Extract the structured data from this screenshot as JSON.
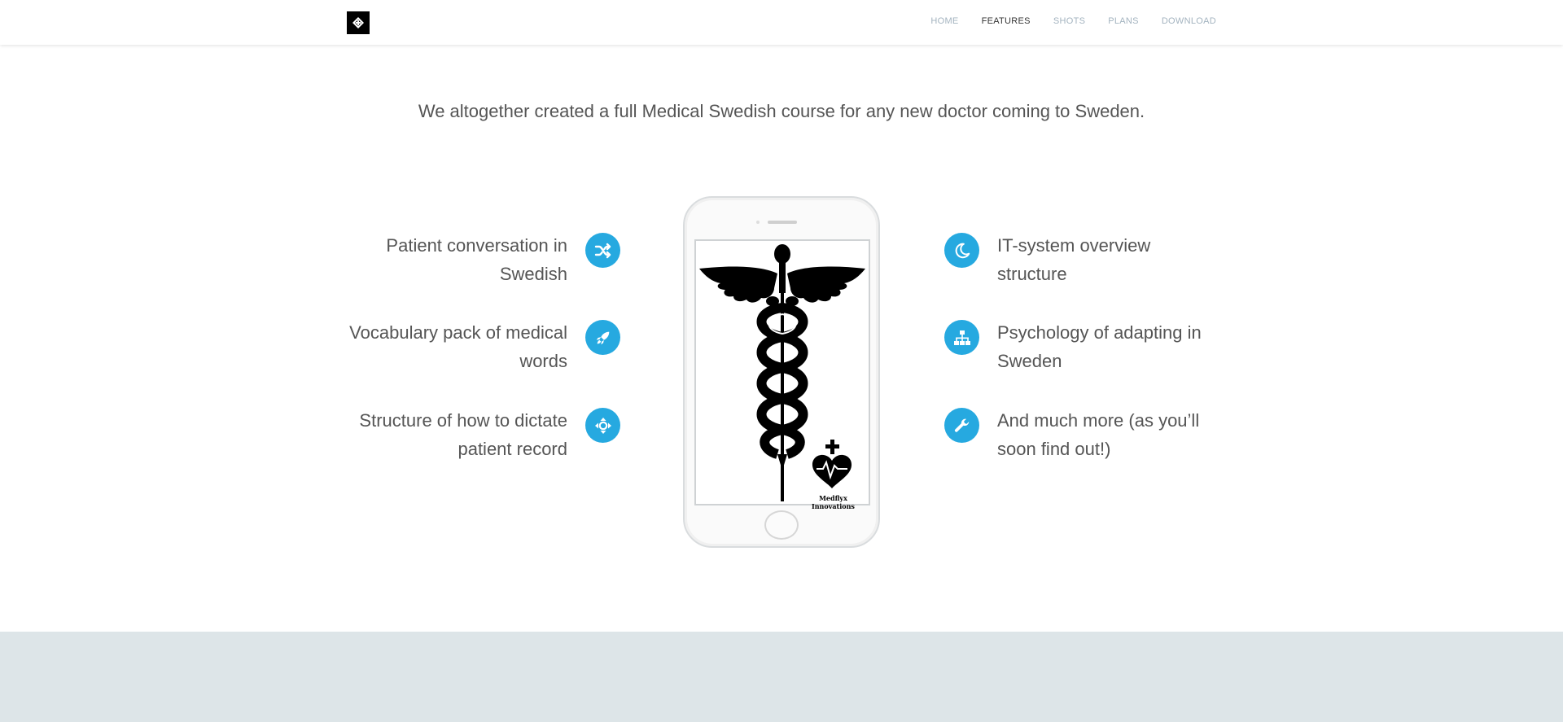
{
  "nav": {
    "items": [
      {
        "label": "HOME",
        "active": false
      },
      {
        "label": "FEATURES",
        "active": true
      },
      {
        "label": "SHOTS",
        "active": false
      },
      {
        "label": "PLANS",
        "active": false
      },
      {
        "label": "DOWNLOAD",
        "active": false
      }
    ]
  },
  "intro": "We altogether created a full Medical Swedish course for any new doctor coming to Sweden.",
  "features_left": [
    {
      "line1": "Patient conversation in",
      "line2": "Swedish",
      "icon": "shuffle-icon"
    },
    {
      "line1": "Vocabulary pack of medical",
      "line2": "words",
      "icon": "rocket-icon"
    },
    {
      "line1": "Structure of how to dictate",
      "line2": "patient record",
      "icon": "move-icon"
    }
  ],
  "features_right": [
    {
      "line1": "IT-system overview",
      "line2": "structure",
      "icon": "moon-icon"
    },
    {
      "line1": "Psychology of adapting in",
      "line2": "Sweden",
      "icon": "sitemap-icon"
    },
    {
      "line1": "And much more (as you’ll",
      "line2": "soon find out!)",
      "icon": "wrench-icon"
    }
  ],
  "phone": {
    "brand_line1": "Medflyx",
    "brand_line2": "Innovations"
  },
  "colors": {
    "accent": "#26a9e0",
    "footer_band": "#dde5e8"
  }
}
